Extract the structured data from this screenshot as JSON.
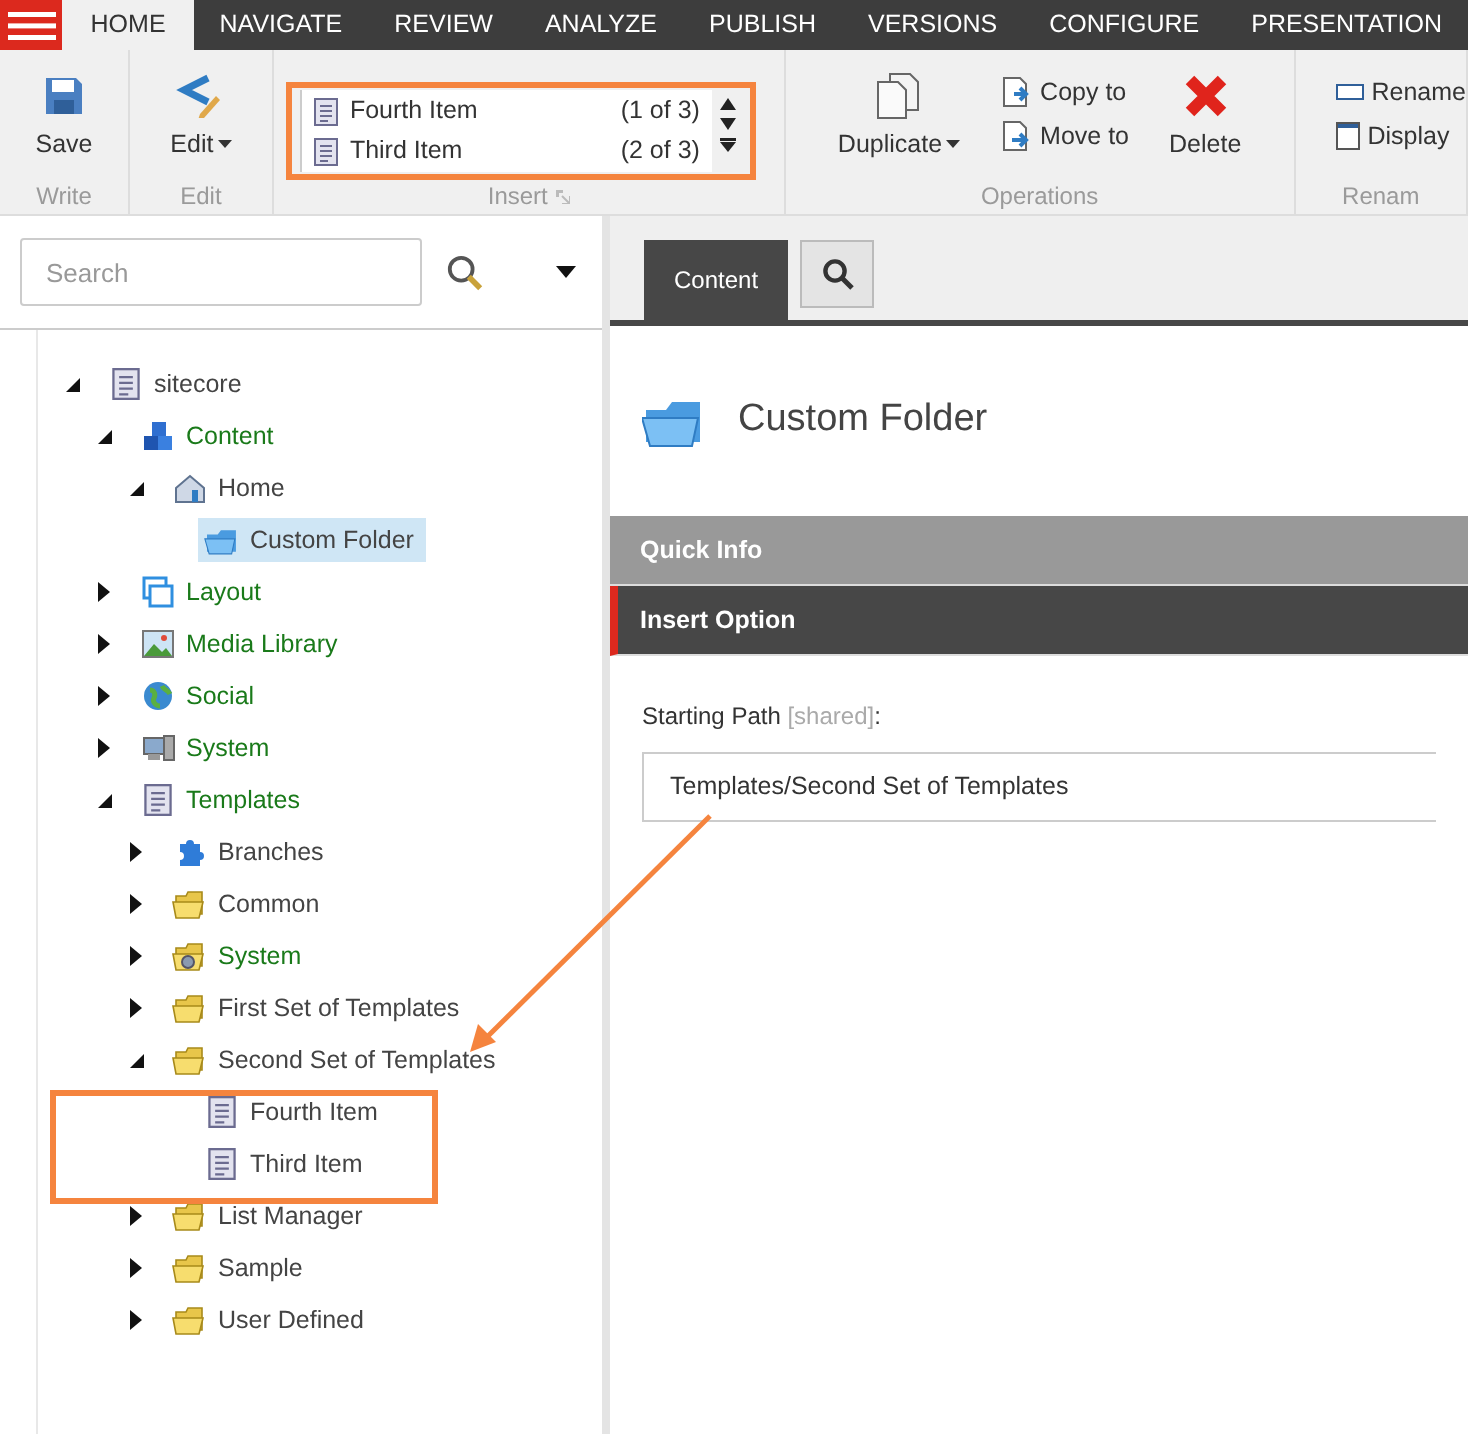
{
  "menu_tabs": [
    {
      "label": "HOME",
      "selected": true
    },
    {
      "label": "NAVIGATE",
      "selected": false
    },
    {
      "label": "REVIEW",
      "selected": false
    },
    {
      "label": "ANALYZE",
      "selected": false
    },
    {
      "label": "PUBLISH",
      "selected": false
    },
    {
      "label": "VERSIONS",
      "selected": false
    },
    {
      "label": "CONFIGURE",
      "selected": false
    },
    {
      "label": "PRESENTATION",
      "selected": false
    }
  ],
  "ribbon": {
    "groups": [
      {
        "label": "Write",
        "kind": "big",
        "buttons": [
          {
            "label": "Save",
            "dropdown": false
          }
        ]
      },
      {
        "label": "Edit",
        "kind": "big",
        "buttons": [
          {
            "label": "Edit",
            "dropdown": true
          }
        ]
      },
      {
        "label": "Insert",
        "kind": "gallery",
        "items": [
          {
            "label": "Fourth Item",
            "count": "(1 of 3)"
          },
          {
            "label": "Third Item",
            "count": "(2 of 3)"
          }
        ]
      },
      {
        "label": "Operations",
        "kind": "mixed",
        "buttons": [
          {
            "label": "Duplicate",
            "dropdown": true,
            "kind": "big"
          },
          {
            "label": "Copy to",
            "dropdown": false,
            "kind": "small"
          },
          {
            "label": "Move to",
            "dropdown": false,
            "kind": "small"
          },
          {
            "label": "Delete",
            "dropdown": false,
            "kind": "big"
          }
        ]
      },
      {
        "label": "Renam",
        "kind": "small",
        "buttons": [
          {
            "label": "Rename",
            "dropdown": false
          },
          {
            "label": "Display",
            "dropdown": false
          }
        ]
      }
    ]
  },
  "search": {
    "placeholder": "Search"
  },
  "tree": [
    {
      "label": "sitecore",
      "kind": "document",
      "expanded": true,
      "children": [
        {
          "label": "Content",
          "kind": "cubes",
          "color": "#1a7a1a",
          "expanded": true,
          "children": [
            {
              "label": "Home",
              "kind": "home",
              "expanded": true,
              "children": [
                {
                  "label": "Custom Folder",
                  "kind": "bluefolder",
                  "selected": true
                }
              ]
            }
          ]
        },
        {
          "label": "Layout",
          "kind": "layout",
          "color": "#1a7a1a",
          "expanded": false
        },
        {
          "label": "Media Library",
          "kind": "media",
          "color": "#1a7a1a",
          "expanded": false
        },
        {
          "label": "Social",
          "kind": "globe",
          "color": "#1a7a1a",
          "expanded": false
        },
        {
          "label": "System",
          "kind": "system",
          "color": "#1a7a1a",
          "expanded": false
        },
        {
          "label": "Templates",
          "kind": "document",
          "color": "#1a7a1a",
          "expanded": true,
          "children": [
            {
              "label": "Branches",
              "kind": "puzzle",
              "expanded": false
            },
            {
              "label": "Common",
              "kind": "folder",
              "expanded": false
            },
            {
              "label": "System",
              "kind": "gearfolder",
              "color": "#1a7a1a",
              "expanded": false
            },
            {
              "label": "First Set of Templates",
              "kind": "folder",
              "expanded": false
            },
            {
              "label": "Second Set of Templates",
              "kind": "folder",
              "expanded": true,
              "children": [
                {
                  "label": "Fourth Item",
                  "kind": "document",
                  "selected": false
                },
                {
                  "label": "Third Item",
                  "kind": "document",
                  "selected": false
                }
              ]
            },
            {
              "label": "List Manager",
              "kind": "folder",
              "expanded": false
            },
            {
              "label": "Sample",
              "kind": "folder",
              "expanded": false
            },
            {
              "label": "User Defined",
              "kind": "folder",
              "expanded": false
            }
          ]
        }
      ]
    }
  ],
  "editor_tabs": [
    {
      "label": "Content",
      "kind": "text",
      "selected": true
    },
    {
      "kind": "search",
      "selected": false
    }
  ],
  "item_title": "Custom Folder",
  "sections": [
    {
      "title": "Quick Info",
      "expanded": false
    },
    {
      "title": "Insert Option",
      "expanded": true
    }
  ],
  "field": {
    "label": "Starting Path",
    "shared": "[shared]",
    "colon": ":",
    "value": "Templates/Second Set of Templates"
  }
}
